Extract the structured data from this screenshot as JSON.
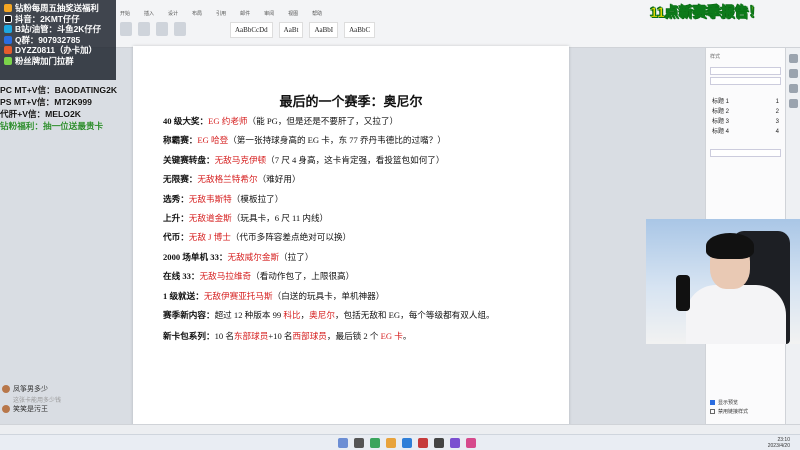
{
  "ribbon": {
    "menu": [
      "开始",
      "插入",
      "设计",
      "布局",
      "引用",
      "邮件",
      "审阅",
      "视图",
      "帮助"
    ],
    "styles": [
      "AaBbCcDd",
      "AaBt",
      "AaBbI",
      "AaBbC"
    ]
  },
  "document": {
    "title": "最后的一个赛季：奥尼尔",
    "lines": [
      {
        "label": "40 级大奖：",
        "red": "EG 约老师",
        "rest": "（能 PG，但是还是不要肝了，又拉了）"
      },
      {
        "label": "称霸赛：",
        "red": "EG 哈登",
        "rest": "（第一张持球身高的 EG 卡，东 77 乔丹韦德比的过嘴？）"
      },
      {
        "label": "关键赛转盘：",
        "red": "无敌马克伊顿",
        "rest": "（7 尺 4 身高，这卡肯定强，看投篮包如何了）"
      },
      {
        "label": "无限赛：",
        "red": "无敌格兰特希尔",
        "rest": "（难好用）"
      },
      {
        "label": "选秀：",
        "red": "无敌韦斯特",
        "rest": "（模板拉了）"
      },
      {
        "label": "上升：",
        "red": "无敌道金斯",
        "rest": "（玩具卡，6 尺 11 内线）"
      },
      {
        "label": "代币：",
        "red": "无敌 J 博士",
        "rest": "（代币多阵容差点绝对可以换）"
      },
      {
        "label": "2000 场单机 33：",
        "red": "无敌威尔金斯",
        "rest": "（拉了）"
      },
      {
        "label": "在线 33：",
        "red": "无敌马拉维奇",
        "rest": "（看动作包了，上限很高）"
      },
      {
        "label": "1 级就送：",
        "red": "无敌伊赛亚托马斯",
        "rest": "（白送的玩具卡，单机神器）"
      }
    ],
    "new_content": {
      "label": "赛季新内容：",
      "a": "超过 12 种版本 99 ",
      "b": "科比",
      "c": "，",
      "d": "奥尼尔",
      "e": "，包括无敌和 EG，每个等级都有双人组。"
    },
    "new_pack": {
      "label": "新卡包系列：",
      "a": "10 名",
      "b": "东部球员",
      "c": "+10 名",
      "d": "西部球员",
      "e": "，最后锁 2 个 ",
      "f": "EG 卡",
      "g": "。"
    }
  },
  "panel": {
    "title": "样式",
    "heading_items": [
      {
        "name": "标题 1",
        "num": "1"
      },
      {
        "name": "标题 2",
        "num": "2"
      },
      {
        "name": "标题 3",
        "num": "3"
      },
      {
        "name": "标题 4",
        "num": "4"
      }
    ],
    "options": [
      "显示预览",
      "禁用链接样式"
    ]
  },
  "overlay": {
    "info": [
      "钻粉每周五抽奖送福利",
      "抖音：2KMT仔仔",
      "B站/油管：斗鱼2K仔仔",
      "Q群：907932785",
      "DYZZ0811（办卡加）",
      "粉丝牌加门拉群"
    ],
    "promo": [
      {
        "text": "PC MT+V信：BAODATING2K",
        "green": false
      },
      {
        "text": "PS MT+V信：MT2K999",
        "green": false
      },
      {
        "text": "代肝+V信：MELO2K",
        "green": false
      },
      {
        "text": "钻粉福利：抽一位送最贵卡",
        "green": true
      }
    ],
    "banner": "11点新赛季报告！"
  },
  "chat": [
    {
      "user": "凤筝男多少",
      "sub": "这张卡能用多少钱"
    },
    {
      "user": "笑笑是污王",
      "sub": ""
    }
  ],
  "taskbar": {
    "time": "23:10",
    "date": "2023/4/20"
  }
}
